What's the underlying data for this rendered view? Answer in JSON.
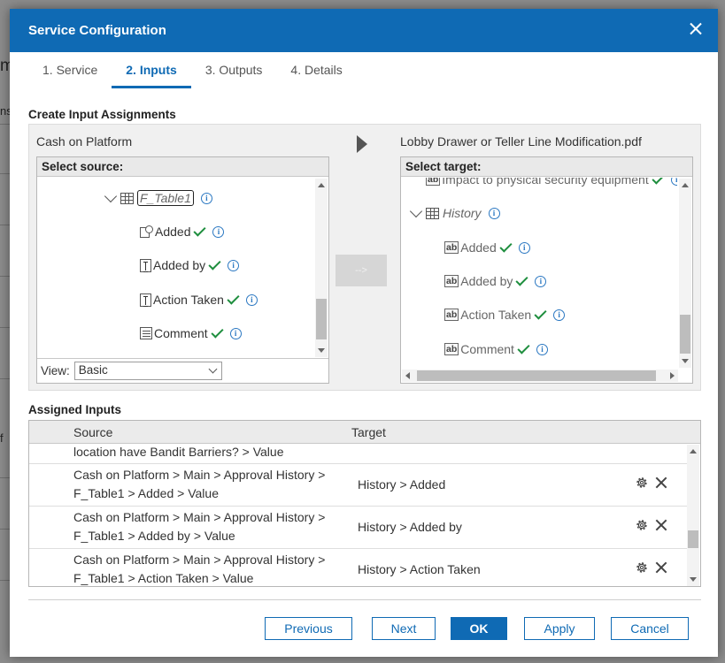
{
  "background": {
    "fragments": [
      "m",
      "ns",
      "f"
    ]
  },
  "dialog": {
    "title": "Service Configuration",
    "tabs": [
      {
        "label": "1. Service",
        "active": false
      },
      {
        "label": "2. Inputs",
        "active": true
      },
      {
        "label": "3. Outputs",
        "active": false
      },
      {
        "label": "4. Details",
        "active": false
      }
    ]
  },
  "create": {
    "heading": "Create Input Assignments",
    "source": {
      "document": "Cash on Platform",
      "header": "Select source:",
      "nodes": [
        {
          "label": "F_Table1"
        },
        {
          "label": "Added"
        },
        {
          "label": "Added by"
        },
        {
          "label": "Action Taken"
        },
        {
          "label": "Comment"
        }
      ],
      "view_label": "View:",
      "view_value": "Basic"
    },
    "map_button": "-->",
    "target": {
      "document": "Lobby Drawer or Teller Line Modification.pdf",
      "header": "Select target:",
      "nodes": [
        {
          "label": "Impact to physical security equipment"
        },
        {
          "label": "History"
        },
        {
          "label": "Added"
        },
        {
          "label": "Added by"
        },
        {
          "label": "Action Taken"
        },
        {
          "label": "Comment"
        }
      ]
    }
  },
  "assigned": {
    "heading": "Assigned Inputs",
    "columns": {
      "source": "Source",
      "target": "Target"
    },
    "rows": [
      {
        "source_line1": "location have Bandit Barriers? > Value",
        "source_line2": "",
        "target": ""
      },
      {
        "source_line1": "Cash on Platform > Main > Approval History >",
        "source_line2": "F_Table1 > Added > Value",
        "target": "History > Added"
      },
      {
        "source_line1": "Cash on Platform > Main > Approval History >",
        "source_line2": "F_Table1 > Added by > Value",
        "target": "History > Added by"
      },
      {
        "source_line1": "Cash on Platform > Main > Approval History >",
        "source_line2": "F_Table1 > Action Taken > Value",
        "target": "History > Action Taken"
      }
    ]
  },
  "buttons": {
    "previous": "Previous",
    "next": "Next",
    "ok": "OK",
    "apply": "Apply",
    "cancel": "Cancel"
  },
  "icons": {
    "check_color": "#1e8e3e",
    "info_color": "#2b78c2",
    "accent": "#0f6ab4"
  }
}
